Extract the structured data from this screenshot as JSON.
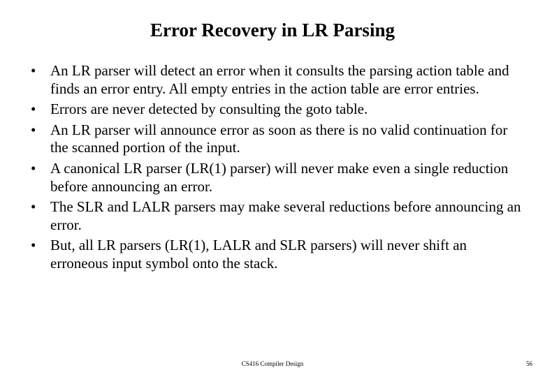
{
  "title": "Error Recovery in LR Parsing",
  "bullets": [
    "An LR parser will detect an error when it consults the parsing action table and finds an error entry. All empty entries in the action table are error entries.",
    "Errors are never detected by consulting the goto table.",
    "An LR parser will announce error as soon as there is no valid continuation for the scanned portion of the input.",
    "A canonical LR parser (LR(1) parser) will never make even a single reduction before announcing an error.",
    "The SLR and LALR parsers may make several reductions before announcing an error.",
    "But, all LR parsers (LR(1), LALR and SLR parsers) will never shift an erroneous input symbol onto the stack."
  ],
  "footer": {
    "center": "CS416 Compiler Design",
    "page": "56"
  }
}
